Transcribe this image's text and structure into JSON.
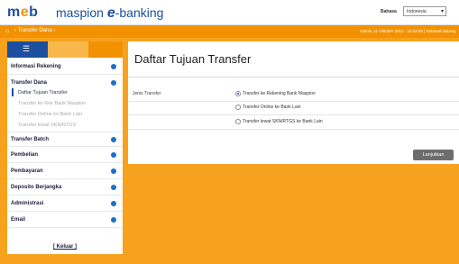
{
  "header": {
    "logo_m": "m",
    "logo_e": "e",
    "logo_b": "b",
    "brand_prefix": "maspion ",
    "brand_e": "e",
    "brand_suffix": "-banking",
    "lang_label": "Bahasa",
    "lang_value": "Indonesia"
  },
  "navbar": {
    "breadcrumb": "Transfer Dana",
    "datetime": "Kamis, 11 Oktober 2012 - 10:44:00 | Selamat Datang"
  },
  "sidebar": {
    "items": [
      {
        "label": "Informasi Rekening"
      },
      {
        "label": "Transfer Dana"
      },
      {
        "label": "Transfer Batch"
      },
      {
        "label": "Pembelian"
      },
      {
        "label": "Pembayaran"
      },
      {
        "label": "Deposito Berjangka"
      },
      {
        "label": "Administrasi"
      },
      {
        "label": "Email"
      }
    ],
    "submenu": [
      "Daftar Tujuan Transfer",
      "Transfer ke Rek Bank Maspion",
      "Transfer Online ke Bank Lain",
      "Transfer lewat SKN/RTGS"
    ],
    "logout": "[ Keluar ]"
  },
  "main": {
    "title": "Daftar Tujuan Transfer",
    "form_label": "Jenis Transfer",
    "options": [
      "Transfer ke Rekening Bank Maspion",
      "Transfer Online ke Bank Lain",
      "Transfer lewat SKN/RTGS ke Bank Lain"
    ],
    "selected_option": 0,
    "next_button": "Lanjutkan"
  },
  "colors": {
    "accent_orange": "#f39200",
    "brand_blue": "#1c4fa0",
    "background": "#f7a21f"
  }
}
